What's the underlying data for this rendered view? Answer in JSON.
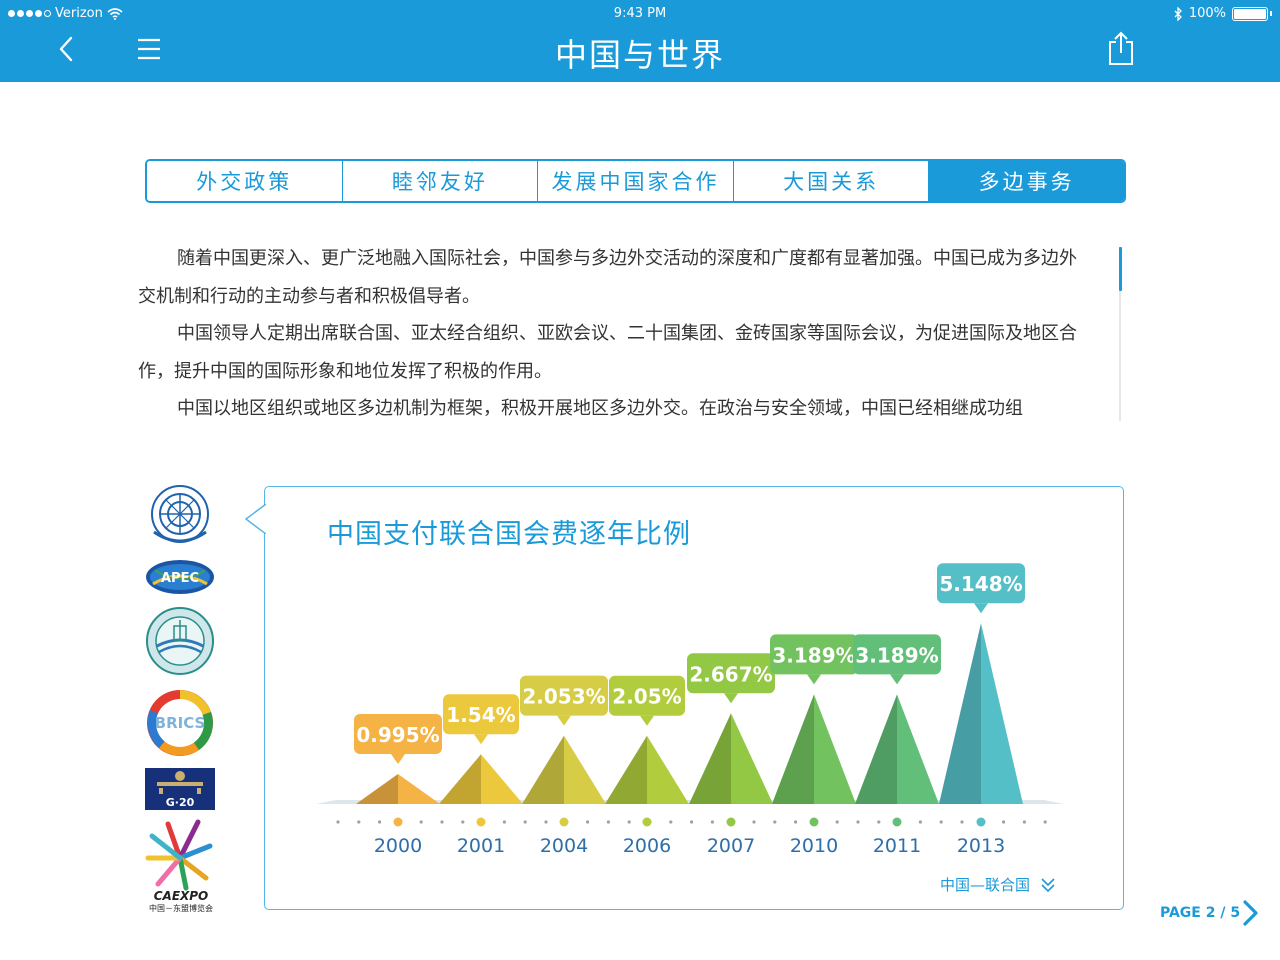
{
  "status": {
    "carrier": "Verizon",
    "time": "9:43 PM",
    "battery": "100%"
  },
  "nav": {
    "title": "中国与世界"
  },
  "tabs": [
    {
      "label": "外交政策",
      "active": false
    },
    {
      "label": "睦邻友好",
      "active": false
    },
    {
      "label": "发展中国家合作",
      "active": false
    },
    {
      "label": "大国关系",
      "active": false
    },
    {
      "label": "多边事务",
      "active": true
    }
  ],
  "article": {
    "paragraphs": [
      "随着中国更深入、更广泛地融入国际社会，中国参与多边外交活动的深度和广度都有显著加强。中国已成为多边外交机制和行动的主动参与者和积极倡导者。",
      "中国领导人定期出席联合国、亚太经合组织、亚欧会议、二十国集团、金砖国家等国际会议，为促进国际及地区合作，提升中国的国际形象和地位发挥了积极的作用。",
      "中国以地区组织或地区多边机制为框架，积极开展地区多边外交。在政治与安全领域，中国已经相继成功组"
    ]
  },
  "logos": {
    "apec": "APEC",
    "brics": "BRICS",
    "g20": "G·20",
    "caexpo": "CAEXPO",
    "caexpo_sub": "中国－东盟博览会"
  },
  "chart_data": {
    "type": "bar",
    "title": "中国支付联合国会费逐年比例",
    "categories": [
      "2000",
      "2001",
      "2004",
      "2006",
      "2007",
      "2010",
      "2011",
      "2013"
    ],
    "values": [
      0.995,
      1.54,
      2.053,
      2.05,
      2.667,
      3.189,
      3.189,
      5.148
    ],
    "labels": [
      "0.995%",
      "1.54%",
      "2.053%",
      "2.05%",
      "2.667%",
      "3.189%",
      "3.189%",
      "5.148%"
    ],
    "colors": [
      "#f4b344",
      "#ecc83c",
      "#d7cc45",
      "#b1cd3e",
      "#92c843",
      "#72c35f",
      "#62bf7a",
      "#55bfc8"
    ],
    "legend": "none"
  },
  "footer": {
    "link": "中国—联合国",
    "page": "PAGE 2 / 5"
  },
  "accent": "#1a9ad9"
}
